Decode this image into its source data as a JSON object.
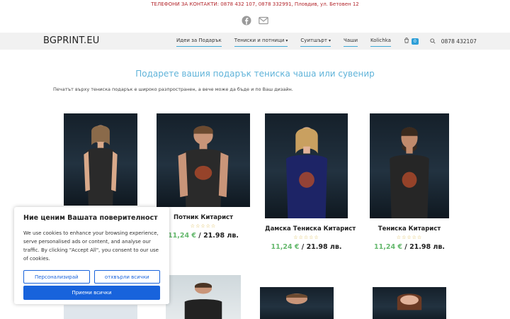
{
  "topbar": {
    "phones": "ТЕЛЕФОНИ ЗА КОНТАКТИ: 0878 432 107, 0878 332991, Пловдив, ул. Бетовен 12"
  },
  "nav": {
    "logo": "BGPRINT.EU",
    "items": [
      {
        "label": "Идеи за Подарък",
        "caret": false
      },
      {
        "label": "Тениски и потници",
        "caret": true
      },
      {
        "label": "Суитшърт",
        "caret": true
      },
      {
        "label": "Чаши",
        "caret": false
      },
      {
        "label": "Kolichka",
        "caret": false
      }
    ],
    "cart_count": "0",
    "phone": "0878 432107"
  },
  "hero": {
    "title": "Подарете вашия подарък тениска чаша или сувенир",
    "intro": "Печатът върху тениска подарък е  широко разпространен, а вече може да бъде и по Ваш дизайн."
  },
  "products": [
    {
      "name": "Потник Китарист",
      "stars": "☆☆☆☆☆",
      "price_eur": "11,24 €",
      "price_sep": " / ",
      "price_lv": "21.98 лв.",
      "shirt_color": "#2a2a2a"
    },
    {
      "name": "Дамска Тениска Китарист",
      "stars": "☆☆☆☆☆",
      "price_eur": "11,24 €",
      "price_sep": " / ",
      "price_lv": "21.98 лв.",
      "shirt_color": "#1d2466"
    },
    {
      "name": "Тениска Китарист",
      "stars": "☆☆☆☆☆",
      "price_eur": "11,24 €",
      "price_sep": " / ",
      "price_lv": "21.98 лв.",
      "shirt_color": "#262626"
    }
  ],
  "cookie": {
    "title": "Ние ценим Вашата поверителност",
    "text": "We use cookies to enhance your browsing experience, serve personalised ads or content, and analyse our traffic. By clicking \"Accept All\", you consent to our use of cookies.",
    "customize": "Персонализирай",
    "reject": "отхвърли всички",
    "accept": "Приеми всички"
  },
  "icons": [
    "facebook-icon",
    "mail-icon",
    "cart-icon",
    "search-icon"
  ]
}
